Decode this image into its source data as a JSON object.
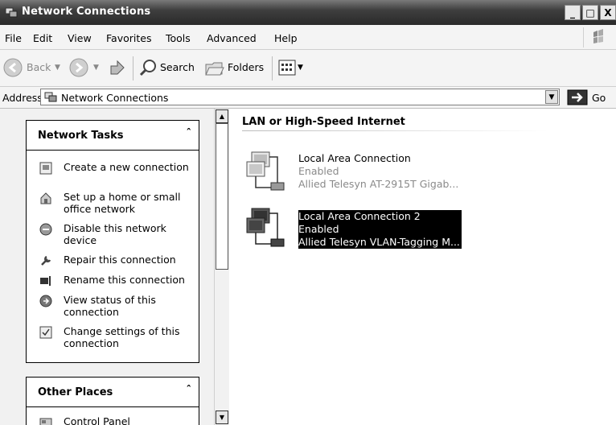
{
  "window": {
    "title": "Network Connections"
  },
  "window_buttons": {
    "minimize": "_",
    "maximize": "□",
    "close": "X"
  },
  "menu": {
    "items": [
      "File",
      "Edit",
      "View",
      "Favorites",
      "Tools",
      "Advanced",
      "Help"
    ]
  },
  "toolbar": {
    "back": "Back",
    "search": "Search",
    "folders": "Folders"
  },
  "address": {
    "label": "Address",
    "value": "Network Connections",
    "go": "Go"
  },
  "network_tasks": {
    "title": "Network Tasks",
    "items": [
      {
        "label": "Create a new connection",
        "icon": "new-connection-icon"
      },
      {
        "label": "Set up a home or small office network",
        "icon": "home-network-icon"
      },
      {
        "label": "Disable this network device",
        "icon": "disable-device-icon"
      },
      {
        "label": "Repair this connection",
        "icon": "wrench-icon"
      },
      {
        "label": "Rename this connection",
        "icon": "rename-icon"
      },
      {
        "label": "View status of this connection",
        "icon": "status-icon"
      },
      {
        "label": "Change settings of this connection",
        "icon": "settings-icon"
      }
    ]
  },
  "other_places": {
    "title": "Other Places",
    "items": [
      {
        "label": "Control Panel",
        "icon": "control-panel-icon"
      }
    ]
  },
  "content": {
    "group_title": "LAN or High-Speed Internet",
    "connections": [
      {
        "name": "Local Area Connection",
        "status": "Enabled",
        "device": "Allied Telesyn AT-2915T Gigab...",
        "selected": false
      },
      {
        "name": "Local Area Connection 2",
        "status": "Enabled",
        "device": "Allied Telesyn VLAN-Tagging M...",
        "selected": true
      }
    ]
  }
}
